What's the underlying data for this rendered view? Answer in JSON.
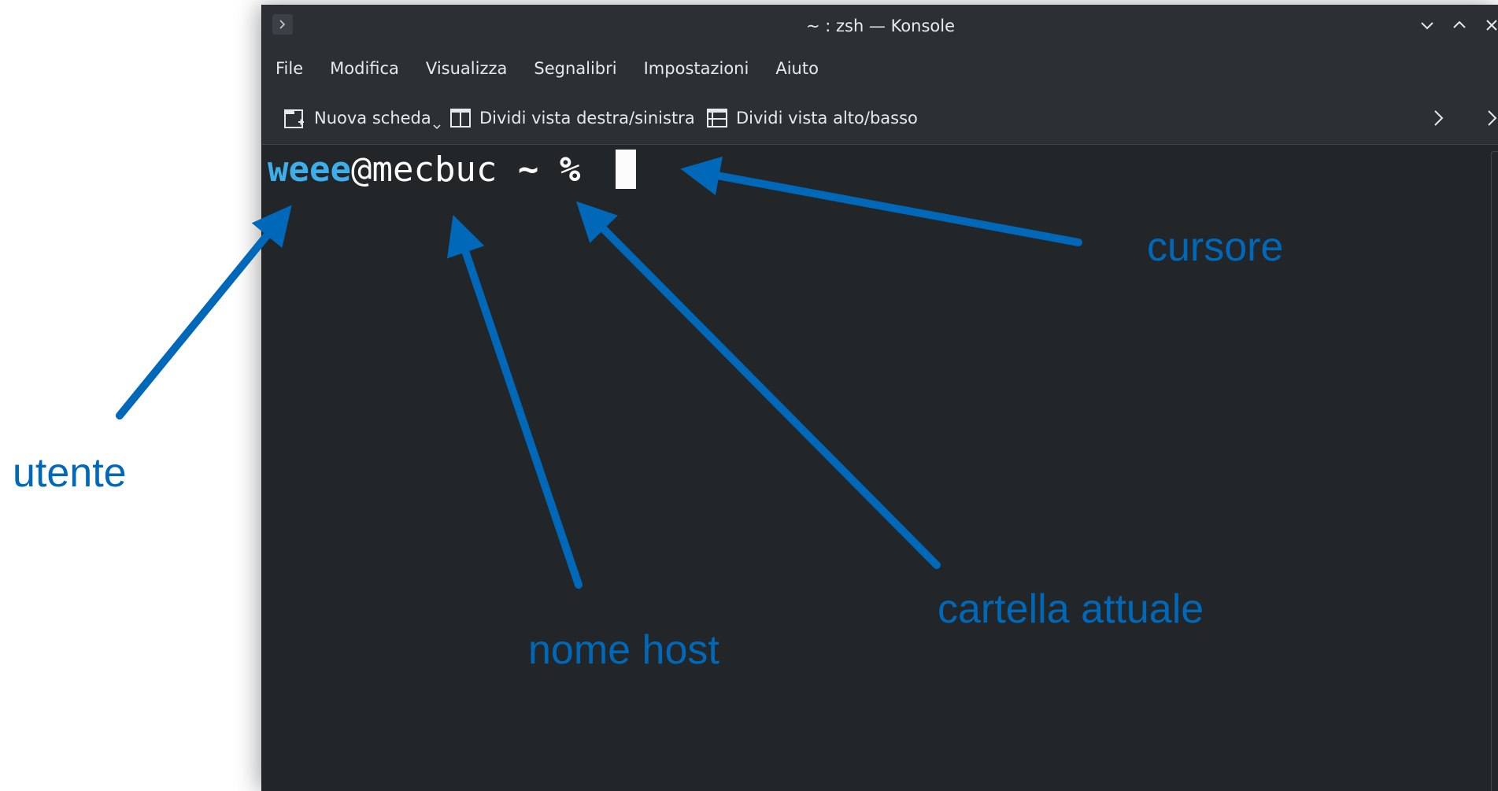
{
  "window": {
    "title": "~ : zsh — Konsole",
    "app_icon": "terminal-icon",
    "controls": [
      "minimize-icon",
      "maximize-icon",
      "close-icon"
    ]
  },
  "menubar": {
    "items": [
      "File",
      "Modifica",
      "Visualizza",
      "Segnalibri",
      "Impostazioni",
      "Aiuto"
    ]
  },
  "toolbar": {
    "new_tab": {
      "label": "Nuova scheda",
      "icon": "new-tab-icon"
    },
    "split_lr": {
      "label": "Dividi vista destra/sinistra",
      "icon": "split-left-right-icon"
    },
    "split_tb": {
      "label": "Dividi vista alto/basso",
      "icon": "split-top-bottom-icon"
    },
    "overflow_icons": [
      "chevron-right-icon",
      "chevron-right-icon"
    ]
  },
  "terminal": {
    "user": "weee",
    "at": "@",
    "host": "mecbuc",
    "dir": "~",
    "symbol": "%"
  },
  "annotations": {
    "user": "utente",
    "host": "nome host",
    "dir": "cartella attuale",
    "cursor": "cursore",
    "color": "#0068b8"
  }
}
